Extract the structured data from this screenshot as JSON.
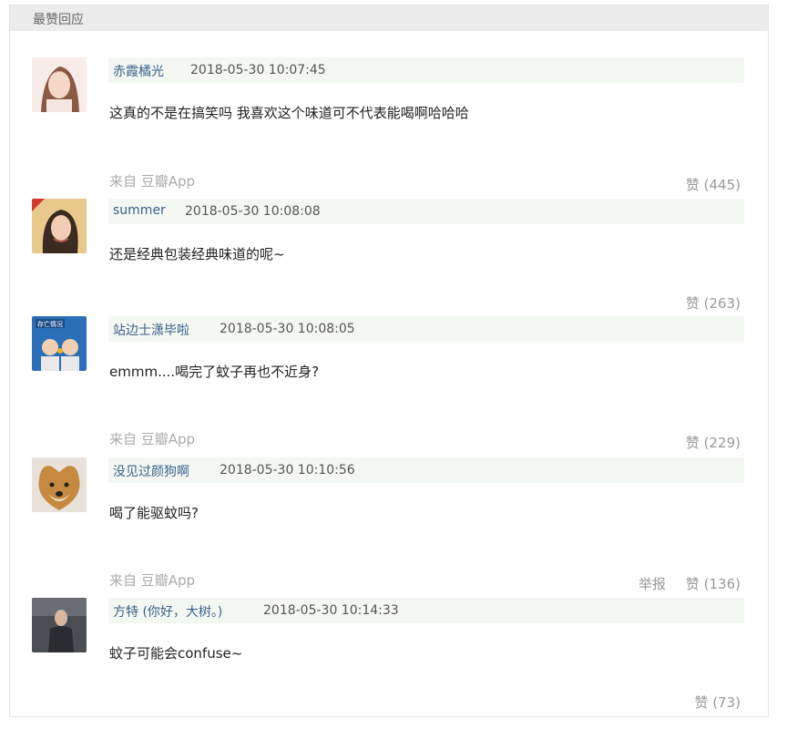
{
  "section": {
    "title": "最赞回应"
  },
  "comments": [
    {
      "author": "赤霞橘光",
      "time": "2018-05-30 10:07:45",
      "content": "这真的不是在搞笑吗 我喜欢这个味道可不代表能喝啊哈哈哈",
      "source": "来自 豆瓣App",
      "like": "赞 (445)",
      "avatar_color": "#f2d9d0"
    },
    {
      "author": "summer",
      "time": "2018-05-30 10:08:08",
      "content": "还是经典包装经典味道的呢~",
      "like": "赞 (263)",
      "avatar_color": "#d8b98f"
    },
    {
      "author": "站边士潇毕啦",
      "time": "2018-05-30 10:08:05",
      "content": "emmm....喝完了蚊子再也不近身?",
      "source": "来自 豆瓣App",
      "like": "赞 (229)",
      "avatar_color": "#2a6fb8",
      "avatar_text": "存亡情况"
    },
    {
      "author": "没见过颜狗啊",
      "time": "2018-05-30 10:10:56",
      "content": "喝了能驱蚊吗?",
      "source": "来自 豆瓣App",
      "report": "举报",
      "like": "赞 (136)",
      "avatar_color": "#c58a3f"
    },
    {
      "author": "方特 (你好，大树。)",
      "time": "2018-05-30 10:14:33",
      "content": "蚊子可能会confuse~",
      "like": "赞 (73)",
      "avatar_color": "#3c3f44"
    }
  ]
}
